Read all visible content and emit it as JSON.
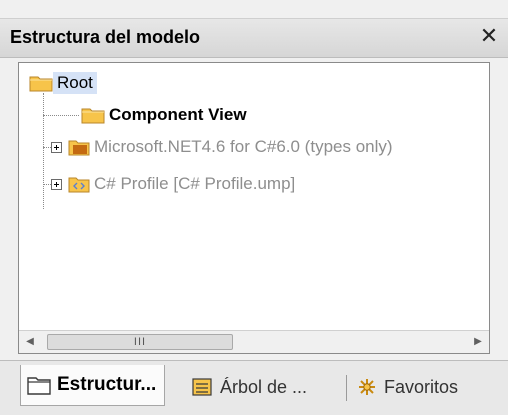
{
  "window": {
    "title": "Estructura del modelo",
    "close_glyph": "✕"
  },
  "tree": {
    "root_label": "Root",
    "items": [
      {
        "label": "Component View",
        "icon": "folder-icon",
        "style": "normal"
      },
      {
        "label": "Microsoft.NET4.6 for C#6.0 (types only)",
        "icon": "csharp-package-icon",
        "style": "gray",
        "badge": "c#"
      },
      {
        "label": "C# Profile [C# Profile.ump]",
        "icon": "profile-package-icon",
        "style": "gray",
        "badge": "<>"
      }
    ]
  },
  "scrollbar": {
    "left_arrow": "◀",
    "right_arrow": "▶",
    "thumb_grip": "III"
  },
  "tabs": [
    {
      "label": "Estructur...",
      "icon": "folder-outline-icon",
      "active": true
    },
    {
      "label": "Árbol de ...",
      "icon": "tree-list-icon",
      "active": false
    },
    {
      "label": "Favoritos",
      "icon": "favorites-icon",
      "active": false
    }
  ],
  "colors": {
    "selection": "#d5e2f6",
    "folder": "#f7c44a",
    "gray_text": "#8e8e8e",
    "csharp_badge": "#d88a1e"
  }
}
